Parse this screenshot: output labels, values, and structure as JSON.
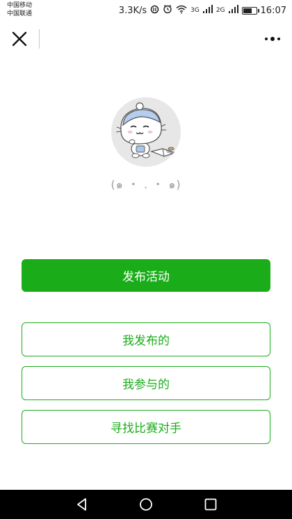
{
  "status_bar": {
    "carrier_1": "中国移动",
    "carrier_2": "中国联通",
    "network_speed": "3.3K/s",
    "signal_1_label": "3G",
    "signal_2_label": "2G",
    "time": "16:07",
    "battery_level": 0.6
  },
  "profile": {
    "avatar_icon": "cartoon-cat-reading-avatar",
    "kaomoji": "(๑ ・ . ・ ๑)"
  },
  "actions": {
    "publish_label": "发布活动",
    "my_published_label": "我发布的",
    "my_joined_label": "我参与的",
    "find_match_label": "寻找比赛对手"
  },
  "colors": {
    "accent": "#1aad19"
  },
  "icons": {
    "close": "close-icon",
    "more": "more-dots-icon",
    "back": "back-triangle-icon",
    "home": "home-circle-icon",
    "recents": "recents-square-icon"
  }
}
